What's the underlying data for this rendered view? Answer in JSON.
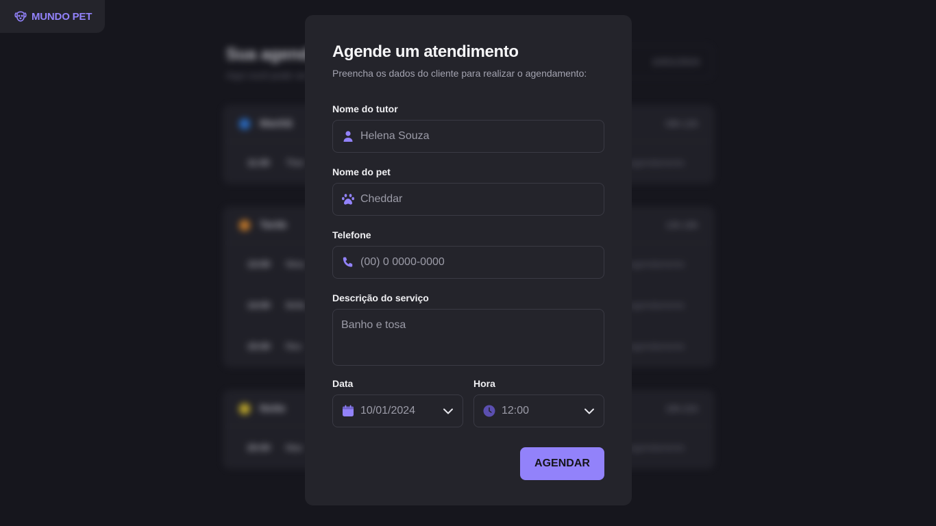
{
  "brand": {
    "name": "MUNDO PET",
    "icon": "dog-icon"
  },
  "background": {
    "title": "Sua agenda",
    "subtitle": "Aqui você pode ver todos os clientes e serviços agendados para o dia.",
    "date": "10/01/2024",
    "periods": [
      {
        "name": "Manhã",
        "range": "09h-12h",
        "icon": "sunrise-icon",
        "color": "#2d7be0",
        "rows": [
          {
            "time": "11:00",
            "name": "Thor",
            "note": "Remover agendamento"
          }
        ]
      },
      {
        "name": "Tarde",
        "range": "13h-18h",
        "icon": "sun-cloud-icon",
        "color": "#e08a2d",
        "rows": [
          {
            "time": "13:00",
            "name": "Nina",
            "note": "Remover agendamento"
          },
          {
            "time": "14:00",
            "name": "Bella",
            "note": "Remover agendamento"
          },
          {
            "time": "15:00",
            "name": "Rex",
            "note": "Remover agendamento"
          }
        ]
      },
      {
        "name": "Noite",
        "range": "19h-21h",
        "icon": "moon-icon",
        "color": "#e0c52d",
        "rows": [
          {
            "time": "20:00",
            "name": "Max",
            "note": "Remover agendamento"
          }
        ]
      }
    ]
  },
  "modal": {
    "title": "Agende um atendimento",
    "subtitle": "Preencha os dados do cliente para realizar o agendamento:",
    "tutor": {
      "label": "Nome do tutor",
      "placeholder": "Helena Souza",
      "icon": "user-icon"
    },
    "pet": {
      "label": "Nome do pet",
      "placeholder": "Cheddar",
      "icon": "paw-icon"
    },
    "phone": {
      "label": "Telefone",
      "placeholder": "(00) 0 0000-0000",
      "icon": "phone-icon"
    },
    "description": {
      "label": "Descrição do serviço",
      "placeholder": "Banho e tosa"
    },
    "date": {
      "label": "Data",
      "value": "10/01/2024",
      "icon": "calendar-icon"
    },
    "time": {
      "label": "Hora",
      "value": "12:00",
      "icon": "clock-icon"
    },
    "submit": "AGENDAR"
  },
  "colors": {
    "accent": "#9282fa",
    "panel": "#24242b",
    "background": "#16161d"
  }
}
